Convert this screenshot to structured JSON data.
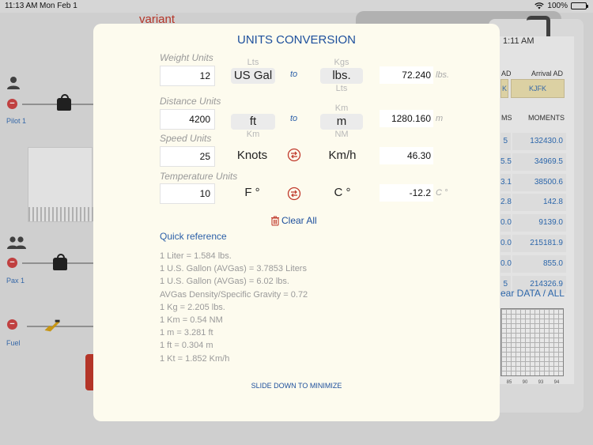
{
  "status_bar": {
    "time": "11:13 AM",
    "date": "Mon Feb 1",
    "battery": "100%",
    "battery_level": 1.0
  },
  "background": {
    "variant_label": "variant",
    "pilot_label": "Pilot 1",
    "pax_label": "Pax 1",
    "fuel_label": "Fuel",
    "clock": "1:11 AM",
    "departure_head": "AD",
    "arrival_head": "Arrival AD",
    "departure_value": "K",
    "arrival_value": "KJFK",
    "arms_head": "MS",
    "moments_head": "MOMENTS",
    "rows": [
      {
        "arm": "5",
        "moment": "132430.0"
      },
      {
        "arm": "5.5",
        "moment": "34969.5"
      },
      {
        "arm": "3.1",
        "moment": "38500.6"
      },
      {
        "arm": "2.8",
        "moment": "142.8"
      },
      {
        "arm": "0.0",
        "moment": "9139.0"
      },
      {
        "arm": "0.0",
        "moment": "215181.9"
      },
      {
        "arm": "0.0",
        "moment": "855.0"
      },
      {
        "arm": "5",
        "moment": "214326.9"
      }
    ],
    "clear_data": "ear DATA / ALL",
    "grid_ticks": [
      "85",
      "90",
      "93",
      "94"
    ]
  },
  "modal": {
    "title": "UNITS CONVERSION",
    "weight": {
      "label": "Weight Units",
      "input": "12",
      "from_above": "Lts",
      "from": "US Gal",
      "from_below": "",
      "to_label": "to",
      "to_above": "Kgs",
      "to": "lbs.",
      "to_below": "Lts",
      "result": "72.240",
      "result_unit": "lbs."
    },
    "distance": {
      "label": "Distance Units",
      "input": "4200",
      "from_above": "",
      "from": "ft",
      "from_below": "Km",
      "to_label": "to",
      "to_above": "Km",
      "to": "m",
      "to_below": "NM",
      "result": "1280.160",
      "result_unit": "m"
    },
    "speed": {
      "label": "Speed Units",
      "input": "25",
      "from": "Knots",
      "to": "Km/h",
      "result": "46.30"
    },
    "temperature": {
      "label": "Temperature Units",
      "input": "10",
      "from": "F °",
      "to": "C °",
      "result": "-12.2",
      "result_unit": "C °"
    },
    "clear_all": "Clear All",
    "quick_reference_title": "Quick reference",
    "quick_reference": [
      "1  Liter = 1.584 lbs.",
      "1  U.S. Gallon (AVGas) = 3.7853 Liters",
      "1  U.S. Gallon (AVGas) = 6.02 lbs.",
      "AVGas Density/Specific Gravity = 0.72",
      "1  Kg = 2.205 lbs.",
      "1  Km = 0.54 NM",
      "1  m = 3.281 ft",
      "1  ft = 0.304 m",
      "1  Kt = 1.852 Km/h"
    ],
    "slide_down": "SLIDE DOWN TO MINIMIZE"
  },
  "colors": {
    "accent": "#1d4f9c",
    "swap_icon": "#c0392b",
    "modal_bg": "#fdfbee"
  }
}
